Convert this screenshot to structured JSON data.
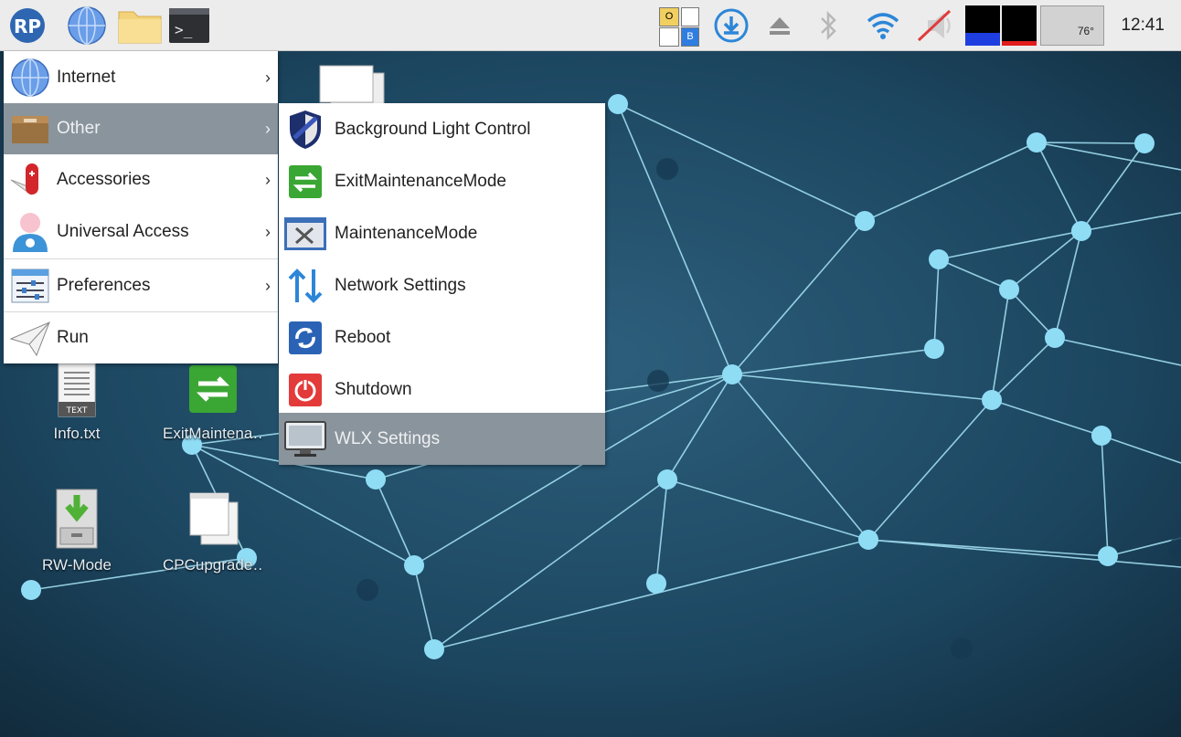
{
  "taskbar": {
    "logo": "RP",
    "launchers": [
      {
        "name": "globe-icon"
      },
      {
        "name": "folder-icon"
      },
      {
        "name": "terminal-icon",
        "glyph": ">_"
      }
    ],
    "keyboard_indicator": {
      "top_letter": "O",
      "bottom_letter": "B"
    },
    "temperature": "76°",
    "clock": "12:41"
  },
  "main_menu": {
    "items": [
      {
        "label": "Internet",
        "arrow": "›"
      },
      {
        "label": "Other",
        "arrow": "›"
      },
      {
        "label": "Accessories",
        "arrow": "›"
      },
      {
        "label": "Universal Access",
        "arrow": "›"
      },
      {
        "label": "Preferences",
        "arrow": "›"
      },
      {
        "label": "Run"
      }
    ],
    "active_index": 1
  },
  "sub_menu": {
    "items": [
      {
        "label": "Background Light Control"
      },
      {
        "label": "ExitMaintenanceMode"
      },
      {
        "label": "MaintenanceMode"
      },
      {
        "label": "Network Settings"
      },
      {
        "label": "Reboot"
      },
      {
        "label": "Shutdown"
      },
      {
        "label": "WLX Settings"
      }
    ],
    "active_index": 6
  },
  "desktop_icons": [
    {
      "label": "Info.txt",
      "badge": "TEXT"
    },
    {
      "label": "ExitMaintena…"
    },
    {
      "label": "RW-Mode"
    },
    {
      "label": "CPCupgrade…"
    }
  ],
  "colors": {
    "menu_highlight": "#8a949c",
    "desktop_bg": "#17384f",
    "network_node": "#8fdcf5"
  }
}
